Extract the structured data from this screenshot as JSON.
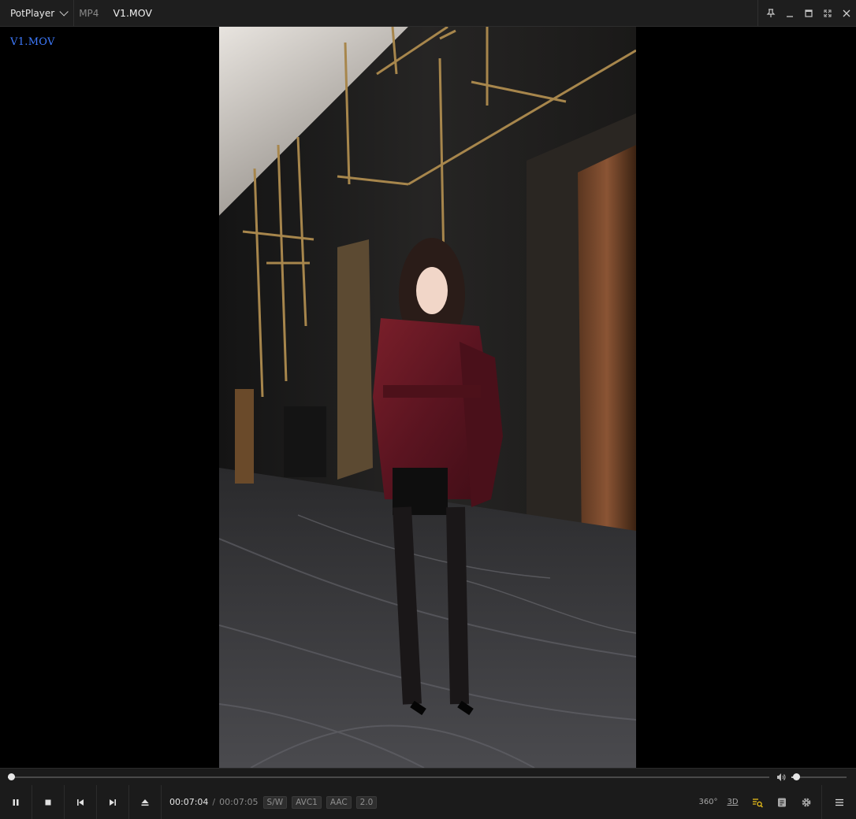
{
  "titlebar": {
    "app_name": "PotPlayer",
    "format": "MP4",
    "title": "V1.MOV"
  },
  "window_controls": [
    "pin-icon",
    "minimize-icon",
    "maximize-icon",
    "fullscreen-icon",
    "close-icon"
  ],
  "video": {
    "osd_text": "V1.MOV"
  },
  "seek": {
    "progress": 0.004,
    "volume": 0.08
  },
  "controls": {
    "buttons": [
      "pause-icon",
      "stop-icon",
      "previous-icon",
      "next-icon",
      "eject-icon"
    ],
    "current_time": "00:07:04",
    "separator": "/",
    "duration": "00:07:05",
    "badges": [
      "S/W",
      "AVC1",
      "AAC",
      "2.0"
    ],
    "vr_label": "360°",
    "threed_label": "3D"
  },
  "colors": {
    "osd_blue": "#3e7bff",
    "playlist_accent": "#f0c419"
  }
}
